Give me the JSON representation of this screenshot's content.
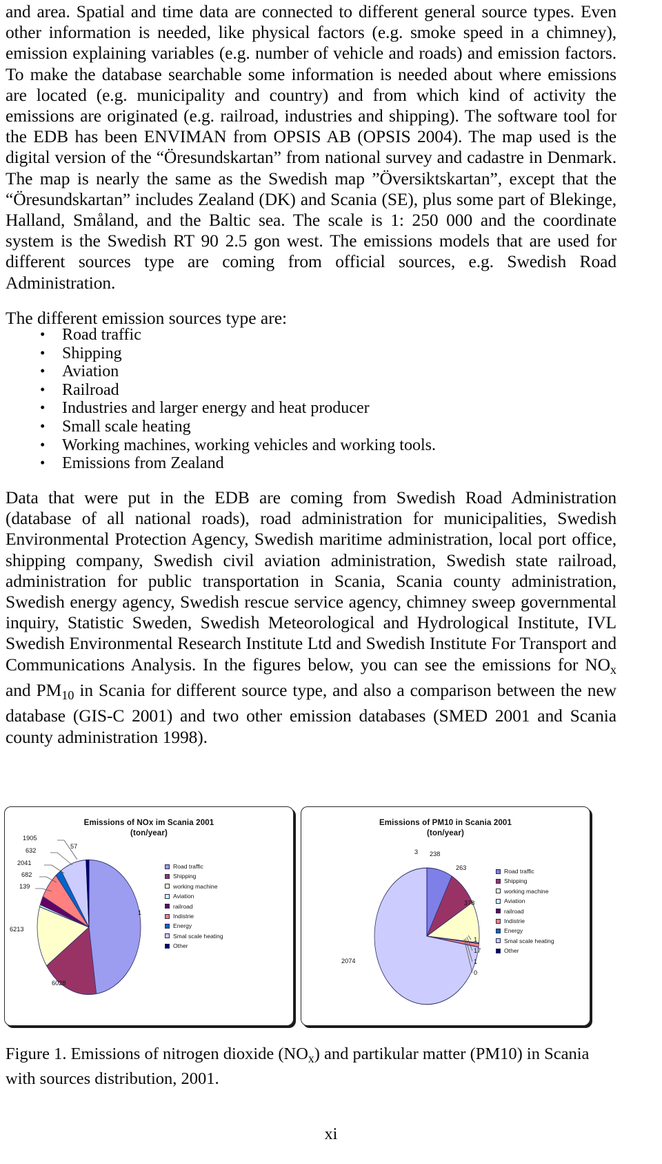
{
  "page": {
    "folio": "xi"
  },
  "paragraphs": {
    "p1_html": "and area. Spatial and time data are connected to different general source types. Even other information is needed, like physical factors (e.g. smoke speed in a chimney), emission explaining variables (e.g. number of vehicle and roads) and emission factors. To make the database searchable some information is needed about where emissions are located (e.g. municipality and country) and from which kind of activity the emissions are originated (e.g. railroad, industries and shipping). The software tool for the EDB has been ENVIMAN from OPSIS AB (OPSIS 2004). The map used is the digital version of the “Öresundskartan” from national survey and cadastre in Denmark. The map is nearly the same as the Swedish map ”Översiktskartan”, except that the “Öresundskartan” includes Zealand (DK) and Scania (SE), plus some part of Blekinge, Halland, Småland, and the Baltic sea. The scale is 1: 250 000 and the coordinate system is the Swedish RT 90 2.5 gon west. The emissions models that are used for different sources type are coming from official sources, e.g. Swedish Road Administration.",
    "lead_in": "The different emission sources type are:",
    "p3_html": "Data that were put in the EDB are coming from Swedish Road Administration (database of all national roads), road administration for municipalities, Swedish Environmental Protection Agency, Swedish maritime administration, local port office, shipping company, Swedish civil aviation administration, Swedish state railroad, administration for public transportation in Scania, Scania county administration, Swedish energy agency, Swedish rescue service agency, chimney sweep governmental inquiry, Statistic Sweden, Swedish Meteorological and Hydrological Institute, IVL Swedish Environmental Research Institute Ltd and Swedish Institute For Transport and Communications Analysis. In the figures below, you can see the emissions for NO<sub>x</sub> and PM<sub>10</sub> in Scania for different source type, and also a comparison between the new database (GIS-C 2001) and two other emission databases (SMED 2001 and Scania county administration 1998)."
  },
  "bullets": [
    "Road traffic",
    "Shipping",
    "Aviation",
    "Railroad",
    "Industries and larger energy and heat producer",
    "Small scale heating",
    "Working machines, working vehicles and working tools.",
    "Emissions from Zealand"
  ],
  "caption_html": "Figure 1. Emissions of nitrogen dioxide (NO<sub>x</sub>) and partikular matter (PM10) in Scania with sources distribution, 2001.",
  "chart_data": [
    {
      "type": "pie",
      "id": "nox",
      "title": "Emissions of NOx im Scania 2001",
      "subtitle": "(ton/year)",
      "unit": "ton/year",
      "categories": [
        "Road traffic",
        "Shipping",
        "working machine",
        "Aviation",
        "railroad",
        "Indistrie",
        "Energy",
        "Smal scale heating",
        "Other"
      ],
      "values": [
        1,
        6028,
        6213,
        139,
        682,
        2041,
        632,
        1905,
        57
      ],
      "labels": [
        "1",
        "6028",
        "6213",
        "139",
        "682",
        "2041",
        "632",
        "1905",
        "57"
      ],
      "slice_fractions": [
        0.497,
        0.152,
        0.165,
        0.004,
        0.018,
        0.055,
        0.017,
        0.083,
        0.009
      ],
      "colors": [
        "#9c9cf0",
        "#993366",
        "#ffffcc",
        "#ccffff",
        "#660066",
        "#ff8080",
        "#0066cc",
        "#ccccff",
        "#000080"
      ],
      "legend_position": "right",
      "grid": false
    },
    {
      "type": "pie",
      "id": "pm10",
      "title": "Emissions of PM10 in Scania 2001",
      "subtitle": "(ton/year)",
      "unit": "ton/year",
      "categories": [
        "Road traffic",
        "Shipping",
        "working machine",
        "Aviation",
        "railroad",
        "Indistrie",
        "Energy",
        "Smal scale heating",
        "Other"
      ],
      "values": [
        238,
        263,
        378,
        3,
        1,
        17,
        1,
        2074,
        0
      ],
      "labels": [
        "238",
        "263",
        "378",
        "3",
        "1",
        "17",
        "1",
        "2074",
        "0"
      ],
      "slice_fractions": [
        0.079,
        0.088,
        0.126,
        0.001,
        0.0004,
        0.006,
        0.0004,
        0.6995,
        0.0
      ],
      "colors": [
        "#7f7fe8",
        "#993366",
        "#ffffcc",
        "#ccffff",
        "#660066",
        "#ff8080",
        "#0066cc",
        "#ccccff",
        "#000080"
      ],
      "legend_position": "right",
      "grid": false
    }
  ],
  "legend_entries": [
    "Road traffic",
    "Shipping",
    "working machine",
    "Aviation",
    "railroad",
    "Indistrie",
    "Energy",
    "Smal scale heating",
    "Other"
  ],
  "legend_colors": [
    "#9c9cf0",
    "#993366",
    "#ffffcc",
    "#ccffff",
    "#660066",
    "#ff8080",
    "#0066cc",
    "#ccccff",
    "#000080"
  ],
  "nox_data_labels": {
    "l_1905": "1905",
    "l_632": "632",
    "l_2041": "2041",
    "l_682": "682",
    "l_139": "139",
    "l_6213": "6213",
    "l_6028": "6028",
    "l_57": "57",
    "l_1": "1"
  },
  "pm10_data_labels": {
    "l_3": "3",
    "l_238": "238",
    "l_263": "263",
    "l_378": "378",
    "l_1a": "1",
    "l_17": "17",
    "l_1b": "1",
    "l_0": "0",
    "l_2074": "2074"
  }
}
